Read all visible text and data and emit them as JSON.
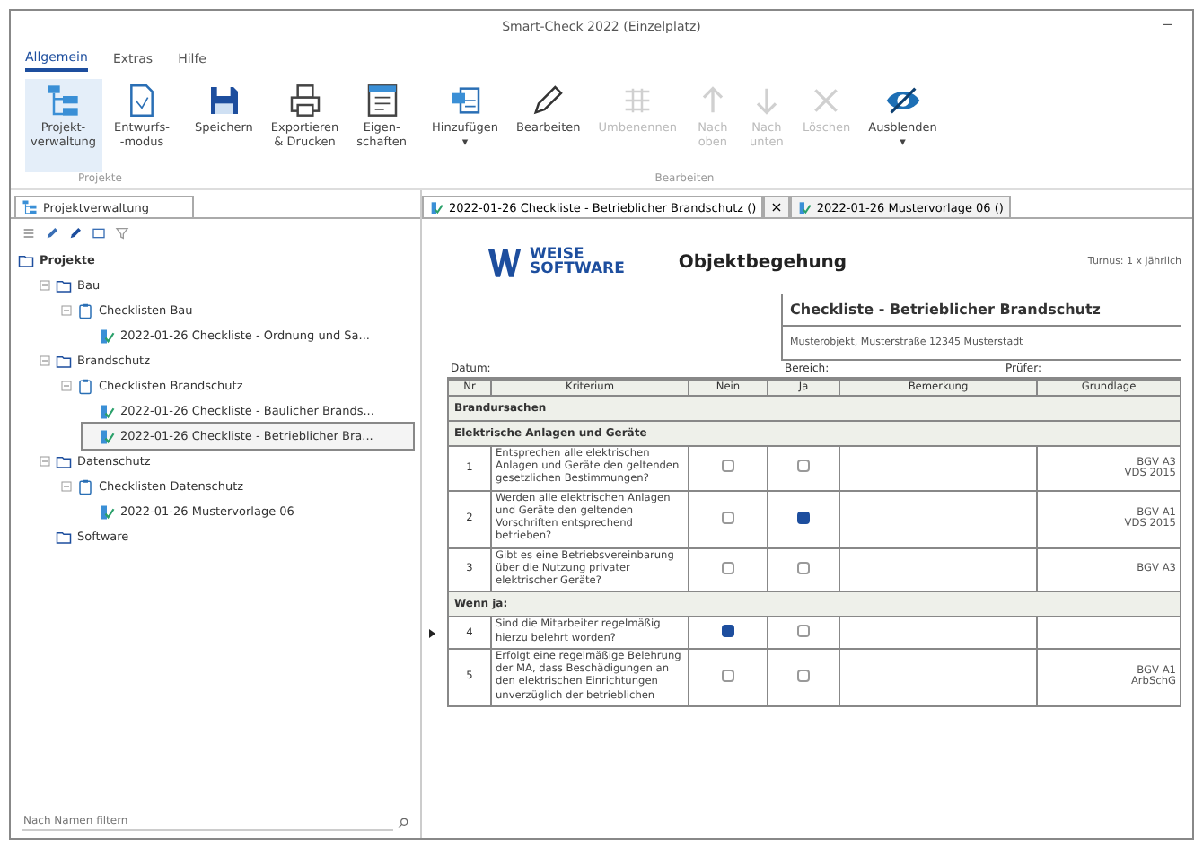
{
  "window": {
    "title": "Smart-Check 2022 (Einzelplatz)",
    "minimize": "–"
  },
  "menu_tabs": [
    {
      "label": "Allgemein",
      "selected": true
    },
    {
      "label": "Extras",
      "selected": false
    },
    {
      "label": "Hilfe",
      "selected": false
    }
  ],
  "ribbon_groups": [
    {
      "label": "Projekte",
      "buttons": [
        {
          "label": "Projekt-\nverwaltung",
          "disabled": false,
          "selected": true
        },
        {
          "label": "Entwurfs-\n-modus",
          "disabled": false,
          "selected": false
        }
      ]
    },
    {
      "buttons": [
        {
          "label": "Speichern",
          "disabled": false,
          "selected": false
        },
        {
          "label": "Exportieren\n& Drucken",
          "disabled": false,
          "selected": false
        },
        {
          "label": "Eigen-\nschaften",
          "disabled": false,
          "selected": false
        }
      ]
    },
    {
      "label": "Bearbeiten",
      "buttons": [
        {
          "label": "Hinzufügen\n▾",
          "disabled": false,
          "selected": false
        },
        {
          "label": "Bearbeiten",
          "disabled": false,
          "selected": false
        },
        {
          "label": "Umbenennen",
          "disabled": true,
          "selected": false
        },
        {
          "label": "Nach\noben",
          "disabled": true,
          "selected": false
        },
        {
          "label": "Nach\nunten",
          "disabled": true,
          "selected": false
        },
        {
          "label": "Löschen",
          "disabled": true,
          "selected": false
        },
        {
          "label": "Ausblenden\n▾",
          "disabled": false,
          "selected": false
        }
      ]
    }
  ],
  "left_panel": {
    "tab": "Projektverwaltung",
    "search": {
      "placeholder": "Nach Namen filtern"
    },
    "tree": [
      {
        "label": "Projekte",
        "kind": "root",
        "selected": false,
        "children": [
          {
            "label": "Bau",
            "kind": "folder",
            "expanded": true,
            "selected": false,
            "children": [
              {
                "label": "Checklisten Bau",
                "kind": "list",
                "expanded": true,
                "selected": false,
                "children": [
                  {
                    "label": "2022-01-26 Checkliste - Ordnung und Sa...",
                    "kind": "doc",
                    "selected": false
                  }
                ]
              }
            ]
          },
          {
            "label": "Brandschutz",
            "kind": "folder",
            "expanded": true,
            "selected": false,
            "children": [
              {
                "label": "Checklisten Brandschutz",
                "kind": "list",
                "expanded": true,
                "selected": false,
                "children": [
                  {
                    "label": "2022-01-26 Checkliste - Baulicher Brands...",
                    "kind": "doc",
                    "selected": false
                  },
                  {
                    "label": "2022-01-26 Checkliste - Betrieblicher Bra...",
                    "kind": "doc",
                    "selected": true
                  }
                ]
              }
            ]
          },
          {
            "label": "Datenschutz",
            "kind": "folder",
            "expanded": true,
            "selected": false,
            "children": [
              {
                "label": "Checklisten Datenschutz",
                "kind": "list",
                "expanded": true,
                "selected": false,
                "children": [
                  {
                    "label": "2022-01-26 Mustervorlage 06",
                    "kind": "doc",
                    "selected": false
                  }
                ]
              }
            ]
          },
          {
            "label": "Software",
            "kind": "folder",
            "selected": false
          }
        ]
      }
    ]
  },
  "doc_tabs": [
    {
      "label": "2022-01-26 Checkliste - Betrieblicher Brandschutz ()",
      "selected": true,
      "close": "×"
    },
    {
      "label": "2022-01-26 Mustervorlage 06 ()",
      "selected": false
    }
  ],
  "document": {
    "logo_line1": "WEISE",
    "logo_line2": "SOFTWARE",
    "title": "Objektbegehung",
    "interval": "Turnus: 1 x jährlich",
    "checklist": "Checkliste - Betrieblicher Brandschutz",
    "address": "Musterobjekt, Musterstraße 12345 Musterstadt",
    "fields": [
      "Datum:",
      "Bereich:",
      "Prüfer:"
    ],
    "columns": [
      "Nr",
      "Kriterium",
      "Nein",
      "Ja",
      "Bemerkung",
      "Grundlage"
    ],
    "rows": [
      {
        "kind": "section",
        "label": "Brandursachen"
      },
      {
        "kind": "section",
        "label": "Elektrische Anlagen und Geräte"
      },
      {
        "kind": "question",
        "nr": "1",
        "text": "Entsprechen alle elektrischen Anlagen und Geräte den geltenden gesetzlichen Bestimmungen?",
        "no": false,
        "yes": false,
        "basis": "BGV A3\nVDS 2015",
        "current": false
      },
      {
        "kind": "question",
        "nr": "2",
        "text": "Werden alle elektrischen Anlagen und Geräte den geltenden Vorschriften entsprechend betrieben?",
        "no": false,
        "yes": true,
        "basis": "BGV A1\nVDS 2015",
        "current": false
      },
      {
        "kind": "question",
        "nr": "3",
        "text": "Gibt es eine Betriebsvereinbarung über die Nutzung privater elektrischer Geräte?",
        "no": false,
        "yes": false,
        "basis": "BGV A3",
        "current": false
      },
      {
        "kind": "section",
        "label": "Wenn ja:"
      },
      {
        "kind": "question",
        "nr": "4",
        "text": "Sind die Mitarbeiter regelmäßig hierzu belehrt worden?",
        "no": true,
        "yes": false,
        "current": true
      },
      {
        "kind": "question",
        "nr": "5",
        "text": "Erfolgt eine regelmäßige Belehrung der MA, dass Beschädigungen an den elektrischen Einrichtungen unverzüglich der betrieblichen",
        "no": false,
        "yes": false,
        "basis": "BGV A1\nArbSchG",
        "current": false
      }
    ]
  }
}
